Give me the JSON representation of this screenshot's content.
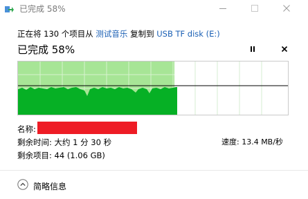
{
  "window": {
    "title": "已完成 58%",
    "icon": "copy-arrow-icon"
  },
  "transfer": {
    "prefix": "正在将 130 个项目从",
    "source": "测试音乐",
    "middle": "复制到",
    "destination": "USB TF disk (E:)"
  },
  "progress": {
    "label": "已完成 58%",
    "fraction": 0.58
  },
  "speed": {
    "label": "速度: 13.4 MB/秒"
  },
  "details": {
    "name_label": "名称:",
    "name_value_redacted": true,
    "time_remaining": "剩余时间: 大约 1 分 30 秒",
    "items_remaining": "剩余项目: 44 (1.06 GB)"
  },
  "footer": {
    "collapse_label": "简略信息"
  },
  "colors": {
    "progress_fill": "#a7e596",
    "throughput_fill": "#06b025",
    "link": "#1a5fb4",
    "redaction": "#ee1c25"
  }
}
